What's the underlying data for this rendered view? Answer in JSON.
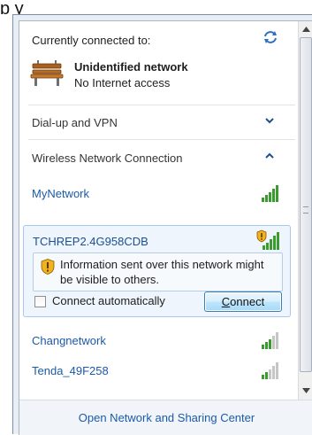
{
  "header": {
    "label": "Currently connected to:"
  },
  "current_network": {
    "name": "Unidentified network",
    "status": "No Internet access"
  },
  "sections": {
    "dialup": {
      "label": "Dial-up and VPN",
      "expanded": false
    },
    "wireless": {
      "label": "Wireless Network Connection",
      "expanded": true
    }
  },
  "networks": [
    {
      "name": "MyNetwork",
      "signal": 5,
      "secured": true
    },
    {
      "name": "TCHREP2.4G958CDB",
      "signal": 5,
      "secured": false,
      "selected": true
    },
    {
      "name": "Changnetwork",
      "signal": 3,
      "secured": true
    },
    {
      "name": "Tenda_49F258",
      "signal": 2,
      "secured": true
    }
  ],
  "selected_network": {
    "warning": "Information sent over this network might be visible to others.",
    "auto_connect_label": "Connect automatically",
    "auto_connect_checked": false,
    "connect_label": "Connect",
    "connect_mnemonic": "C"
  },
  "footer": {
    "link": "Open Network and Sharing Center"
  },
  "colors": {
    "link": "#1b5aa8",
    "signal_strong": "#3a9b2e",
    "signal_weak": "#c6c6c6",
    "warning_shield": "#f0b31c"
  }
}
